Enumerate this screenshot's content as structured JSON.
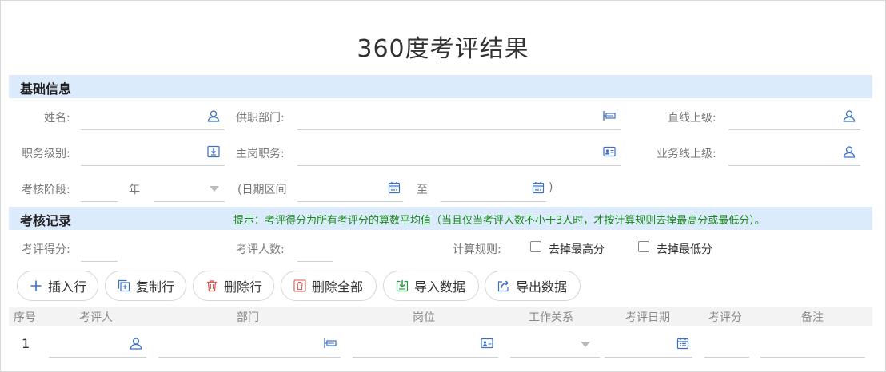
{
  "page": {
    "title": "360度考评结果"
  },
  "basic": {
    "section_title": "基础信息",
    "name_label": "姓名:",
    "dept_label": "供职部门:",
    "direct_superior_label": "直线上级:",
    "job_level_label": "职务级别:",
    "main_post_label": "主岗职务:",
    "business_superior_label": "业务线上级:",
    "stage_label": "考核阶段:",
    "year_label": "年",
    "date_range_label": "(日期区间",
    "to_label": "至",
    "close_paren": ")"
  },
  "record": {
    "section_title": "考核记录",
    "tip": "提示：考评得分为所有考评分的算数平均值（当且仅当考评人数不小于3人时，才按计算规则去掉最高分或最低分）。",
    "score_label": "考评得分:",
    "count_label": "考评人数:",
    "rule_label": "计算规则:",
    "remove_max_label": "去掉最高分",
    "remove_min_label": "去掉最低分"
  },
  "toolbar": {
    "insert": "插入行",
    "copy": "复制行",
    "delete": "删除行",
    "delete_all": "删除全部",
    "import": "导入数据",
    "export": "导出数据"
  },
  "table": {
    "headers": [
      "序号",
      "考评人",
      "部门",
      "岗位",
      "工作关系",
      "考评日期",
      "考评分",
      "备注"
    ],
    "rows": [
      {
        "index": "1"
      }
    ]
  },
  "colors": {
    "section_bg": "#dcebfc",
    "icon_blue": "#3b6fc4",
    "tip_green": "#1a8a1a",
    "delete_red": "#e05555",
    "import_green": "#2e9a4a"
  }
}
